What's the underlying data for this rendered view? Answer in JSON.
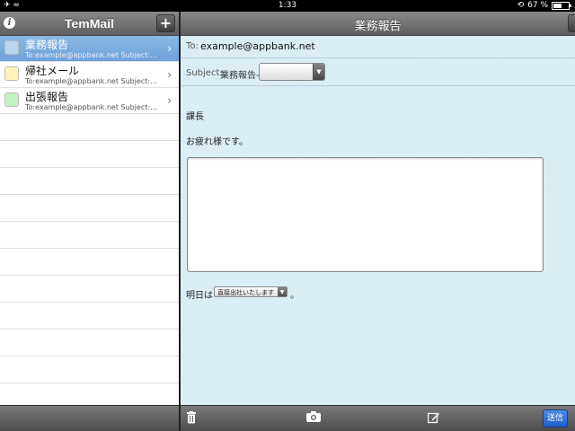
{
  "status_bar": {
    "time": "1:33",
    "battery_text": "67 %",
    "battery_level": 0.67,
    "left_icons": [
      "airplane-icon",
      "wifi-icon"
    ],
    "right_icons": [
      "orientation-lock-icon",
      "battery-icon"
    ]
  },
  "left_nav": {
    "title": "TemMail",
    "add_label": "+",
    "info_label": "i"
  },
  "mails": [
    {
      "title": "業務報告",
      "subtitle": "To:example@appbank.net Subject:業務報告",
      "color": "#b7d6f2",
      "selected": true
    },
    {
      "title": "帰社メール",
      "subtitle": "To:example@appbank.net Subject:帰社メール",
      "color": "#fff3b8",
      "selected": false
    },
    {
      "title": "出張報告",
      "subtitle": "To:example@appbank.net Subject:出張報告",
      "color": "#c3f2c0",
      "selected": false
    }
  ],
  "chevron": "›",
  "right_nav": {
    "title": "業務報告"
  },
  "compose": {
    "to_label": "To:",
    "to_value": "example@appbank.net",
    "subject_label": "Subject:",
    "subject_prefix": "業務報告-",
    "body_line_1": "課長",
    "body_line_2": "お疲れ様です。",
    "tomorrow_prefix": "明日は",
    "tomorrow_select_value": "直接出社いたします",
    "tomorrow_suffix": "。"
  },
  "toolbar": {
    "trash_icon": "trash-icon",
    "camera_icon": "camera-icon",
    "compose_icon": "compose-icon",
    "send_label": "送信"
  },
  "colors": {
    "accent": "#2a6fd6",
    "selected_row": "#79acde",
    "compose_bg": "#d6ebf3"
  }
}
